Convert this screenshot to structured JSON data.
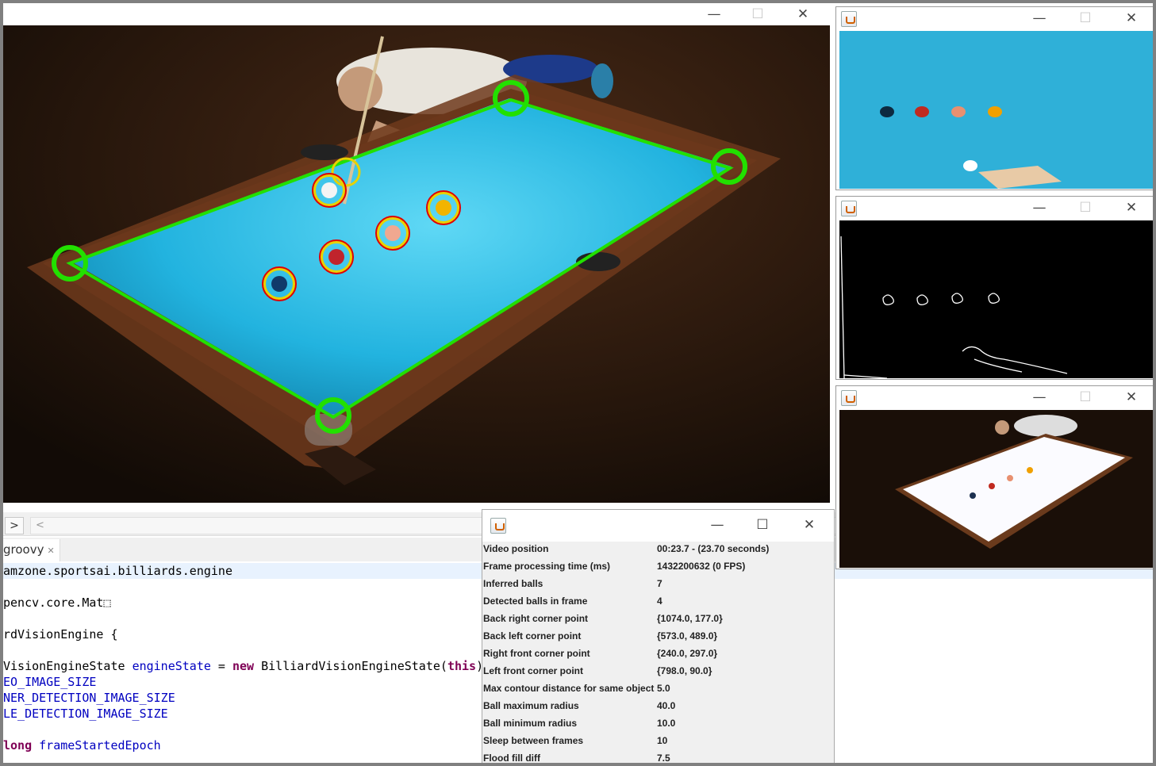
{
  "editor": {
    "chevron": ">",
    "scroll_arrow": "<",
    "tab_label": "groovy",
    "tab_close": "✕",
    "lines": [
      {
        "segments": [
          {
            "t": "amzone.sportsai.billiards.engine",
            "c": ""
          }
        ],
        "hl": true
      },
      {
        "segments": [
          {
            "t": "",
            "c": ""
          }
        ]
      },
      {
        "segments": [
          {
            "t": "pencv.core.Mat",
            "c": ""
          },
          {
            "t": "⬚",
            "c": ""
          }
        ]
      },
      {
        "segments": [
          {
            "t": "",
            "c": ""
          }
        ]
      },
      {
        "segments": [
          {
            "t": "rdVisionEngine {",
            "c": ""
          }
        ]
      },
      {
        "segments": [
          {
            "t": "",
            "c": ""
          }
        ]
      },
      {
        "segments": [
          {
            "t": "VisionEngineState ",
            "c": ""
          },
          {
            "t": "engineState",
            "c": "fld"
          },
          {
            "t": " = ",
            "c": ""
          },
          {
            "t": "new",
            "c": "kw"
          },
          {
            "t": " BilliardVisionEngineState(",
            "c": ""
          },
          {
            "t": "this",
            "c": "kw"
          },
          {
            "t": ")",
            "c": ""
          }
        ]
      },
      {
        "segments": [
          {
            "t": "EO_IMAGE_SIZE",
            "c": "fld"
          }
        ]
      },
      {
        "segments": [
          {
            "t": "NER_DETECTION_IMAGE_SIZE",
            "c": "fld"
          }
        ]
      },
      {
        "segments": [
          {
            "t": "LE_DETECTION_IMAGE_SIZE",
            "c": "fld"
          }
        ]
      },
      {
        "segments": [
          {
            "t": "",
            "c": ""
          }
        ]
      },
      {
        "segments": [
          {
            "t": "long",
            "c": "kw"
          },
          {
            "t": " ",
            "c": ""
          },
          {
            "t": "frameStartedEpoch",
            "c": "fld"
          }
        ]
      }
    ]
  },
  "window_controls": {
    "minimize": "—",
    "maximize": "☐",
    "close": "✕"
  },
  "info_panel": {
    "rows": [
      {
        "label": "Video position",
        "value": "00:23.7 - (23.70 seconds)"
      },
      {
        "label": "Frame processing time (ms)",
        "value": "1432200632 (0 FPS)"
      },
      {
        "label": "Inferred balls",
        "value": "7"
      },
      {
        "label": "Detected balls in frame",
        "value": "4"
      },
      {
        "label": "Back right corner point",
        "value": "{1074.0, 177.0}"
      },
      {
        "label": "Back left corner point",
        "value": "{573.0, 489.0}"
      },
      {
        "label": "Right front corner point",
        "value": "{240.0, 297.0}"
      },
      {
        "label": "Left front corner point",
        "value": "{798.0, 90.0}"
      },
      {
        "label": "Max contour distance for same object",
        "value": "5.0"
      },
      {
        "label": "Ball maximum radius",
        "value": "40.0"
      },
      {
        "label": "Ball minimum radius",
        "value": "10.0"
      },
      {
        "label": "Sleep between frames",
        "value": "10"
      },
      {
        "label": "Flood fill diff",
        "value": "7.5"
      }
    ]
  },
  "colors": {
    "felt": "#27b6e0",
    "rail": "#6b3a1c",
    "detection_green": "#22e000",
    "ball_ring_red": "#e00000",
    "ball_ring_yellow": "#e8d200"
  }
}
